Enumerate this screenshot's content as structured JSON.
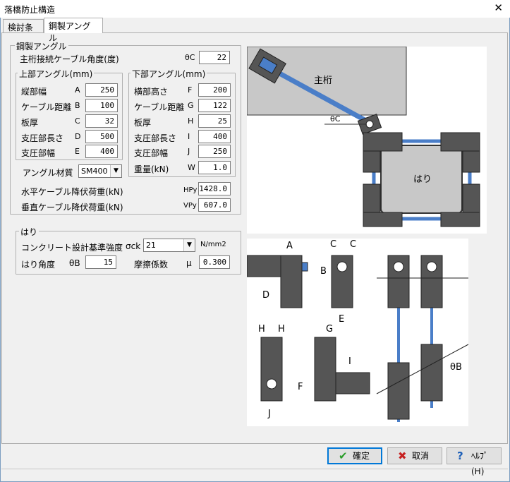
{
  "window": {
    "title": "落橋防止構造",
    "close_glyph": "✕"
  },
  "tabs": [
    {
      "label": "検討条件"
    },
    {
      "label": "鋼製アングル"
    }
  ],
  "steel_angle": {
    "group_title": "鋼製アングル",
    "cable_angle": {
      "label": "主桁接続ケーブル角度(度)",
      "symbol": "θC",
      "value": "22"
    },
    "upper": {
      "title": "上部アングル(mm)",
      "rows": [
        {
          "label": "縦部幅",
          "symbol": "A",
          "value": "250"
        },
        {
          "label": "ケーブル距離",
          "symbol": "B",
          "value": "100"
        },
        {
          "label": "板厚",
          "symbol": "C",
          "value": "32"
        },
        {
          "label": "支圧部長さ",
          "symbol": "D",
          "value": "500"
        },
        {
          "label": "支圧部幅",
          "symbol": "E",
          "value": "400"
        }
      ]
    },
    "lower": {
      "title": "下部アングル(mm)",
      "rows": [
        {
          "label": "横部高さ",
          "symbol": "F",
          "value": "200"
        },
        {
          "label": "ケーブル距離",
          "symbol": "G",
          "value": "122"
        },
        {
          "label": "板厚",
          "symbol": "H",
          "value": "25"
        },
        {
          "label": "支圧部長さ",
          "symbol": "I",
          "value": "400"
        },
        {
          "label": "支圧部幅",
          "symbol": "J",
          "value": "250"
        },
        {
          "label": "重量(kN)",
          "symbol": "W",
          "value": "1.0"
        }
      ]
    },
    "material": {
      "label": "アングル材質",
      "value": "SM400"
    },
    "hpy": {
      "label": "水平ケーブル降伏荷重(kN)",
      "symbol": "HPy",
      "value": "1428.0"
    },
    "vpy": {
      "label": "垂直ケーブル降伏荷重(kN)",
      "symbol": "VPy",
      "value": "607.0"
    }
  },
  "beam": {
    "group_title": "はり",
    "concrete": {
      "label": "コンクリート設計基準強度",
      "symbol": "σck",
      "value": "21",
      "unit": "N/mm2"
    },
    "angle": {
      "label": "はり角度",
      "symbol": "θB",
      "value": "15"
    },
    "friction": {
      "label": "摩擦係数",
      "symbol": "μ",
      "value": "0.300"
    }
  },
  "diagram1": {
    "girder_label": "主桁",
    "beam_label": "はり",
    "angle_label": "θC"
  },
  "diagram2": {
    "labels": [
      "A",
      "B",
      "C",
      "C",
      "D",
      "E",
      "H",
      "H",
      "G",
      "F",
      "I",
      "J",
      "θB"
    ]
  },
  "buttons": {
    "ok": {
      "label": "確定"
    },
    "cancel": {
      "label": "取消"
    },
    "help": {
      "label": "ﾍﾙﾌﾟ(H)"
    }
  },
  "colors": {
    "accent": "#0078d7",
    "cable": "#4a7ec8",
    "steel": "#555555",
    "concrete": "#c8c8c8"
  }
}
